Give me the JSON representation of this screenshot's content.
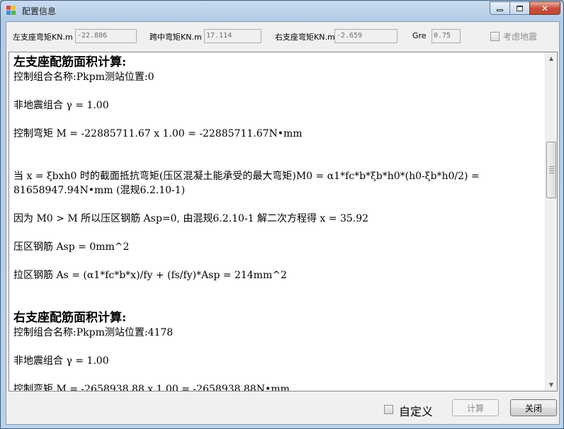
{
  "window": {
    "title": "配置信息",
    "colors": {
      "close": "#c8503b",
      "frame": "#b3cbe6"
    }
  },
  "params": {
    "left_moment_label": "左支座弯矩KN.m",
    "left_moment_value": "-22.886",
    "mid_moment_label": "跨中弯矩KN.m",
    "mid_moment_value": "17.114",
    "right_moment_label": "右支座弯矩KN.m",
    "right_moment_value": "-2.659",
    "gre_label": "Gre",
    "gre_value": "0.75",
    "seismic_label": "考虑地震"
  },
  "results": {
    "left": {
      "heading": "左支座配筋面积计算:",
      "combo": "控制组合名称:Pkpm测站位置:0",
      "nonseismic": "非地震组合 γ = 1.00",
      "moment": "控制弯矩 M = -22885711.67 x 1.00 = -22885711.67N•mm",
      "resist": "当 x = ξbxh0 时的截面抵抗弯矩(压区混凝土能承受的最大弯矩)M0 = α1*fc*b*ξb*h0*(h0-ξb*h0/2) = 81658947.94N•mm  (混规6.2.10-1)",
      "because": "因为 M0 > M 所以压区钢筋 Asp=0, 由混规6.2.10-1 解二次方程得 x = 35.92",
      "comp_steel": "压区钢筋 Asp = 0mm^2",
      "tens_steel": "拉区钢筋 As = (α1*fc*b*x)/fy + (fs/fy)*Asp = 214mm^2"
    },
    "right": {
      "heading": "右支座配筋面积计算:",
      "combo": "控制组合名称:Pkpm测站位置:4178",
      "nonseismic": "非地震组合 γ = 1.00",
      "moment": "控制弯矩 M = -2658938.88 x 1.00 = -2658938.88N•mm"
    }
  },
  "footer": {
    "custom_label": "自定义",
    "calc_label": "计算",
    "close_label": "关闭"
  },
  "icons": [
    "app-icon",
    "minimize-icon",
    "maximize-icon",
    "close-icon",
    "scroll-up-icon",
    "scroll-down-icon"
  ]
}
